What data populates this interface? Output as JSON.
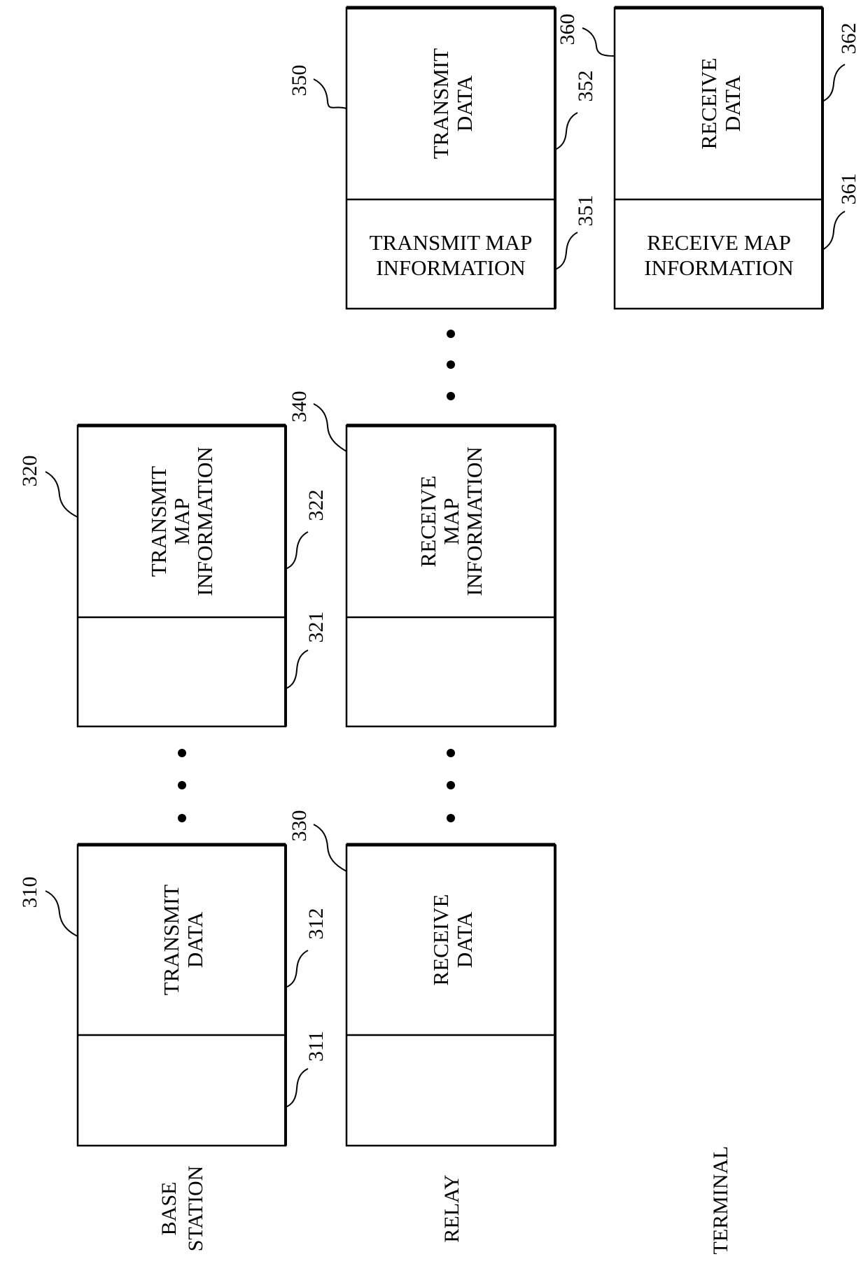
{
  "figure": {
    "row_labels": {
      "base_station": [
        "BASE",
        "STATION"
      ],
      "relay": [
        "RELAY"
      ],
      "terminal": [
        "TERMINAL"
      ]
    },
    "boxes": [
      {
        "id": "310",
        "row": "base_station",
        "parts": [
          {
            "id": "311",
            "label": []
          },
          {
            "id": "312",
            "label": [
              "TRANSMIT",
              "DATA"
            ]
          }
        ]
      },
      {
        "id": "320",
        "row": "base_station",
        "parts": [
          {
            "id": "321",
            "label": []
          },
          {
            "id": "322",
            "label": [
              "TRANSMIT",
              "MAP",
              "INFORMATION"
            ]
          }
        ]
      },
      {
        "id": "330",
        "row": "relay",
        "parts": [
          {
            "id": "",
            "label": []
          },
          {
            "id": "",
            "label": [
              "RECEIVE",
              "DATA"
            ]
          }
        ]
      },
      {
        "id": "340",
        "row": "relay",
        "parts": [
          {
            "id": "",
            "label": []
          },
          {
            "id": "",
            "label": [
              "RECEIVE",
              "MAP",
              "INFORMATION"
            ]
          }
        ]
      },
      {
        "id": "350",
        "row": "relay",
        "parts": [
          {
            "id": "351",
            "label": [
              "TRANSMIT MAP",
              "INFORMATION"
            ]
          },
          {
            "id": "352",
            "label": [
              "TRANSMIT",
              "DATA"
            ]
          }
        ]
      },
      {
        "id": "360",
        "row": "terminal",
        "parts": [
          {
            "id": "361",
            "label": [
              "RECEIVE MAP",
              "INFORMATION"
            ]
          },
          {
            "id": "362",
            "label": [
              "RECEIVE",
              "DATA"
            ]
          }
        ]
      }
    ],
    "ellipsis": "•••"
  }
}
